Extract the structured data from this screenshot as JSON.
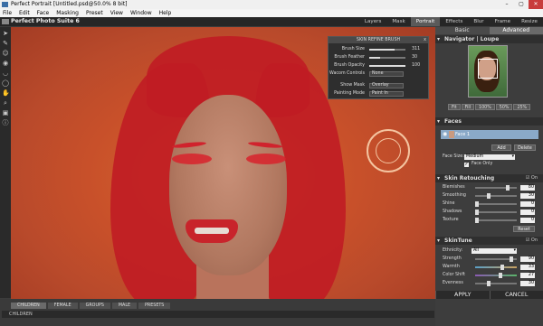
{
  "window": {
    "title": "Perfect Portrait [Untitled.psd@50.0% 8 bit]",
    "min": "–",
    "max": "▢",
    "close": "✕"
  },
  "menu": [
    "File",
    "Edit",
    "Face",
    "Masking",
    "Preset",
    "View",
    "Window",
    "Help"
  ],
  "app": {
    "name": "Perfect Photo Suite 6",
    "modules": [
      "Layers",
      "Mask",
      "Portrait",
      "Effects",
      "Blur",
      "Frame",
      "Resize"
    ],
    "active_module": "Portrait"
  },
  "brush_panel": {
    "title": "SKIN REFINE BRUSH",
    "close": "x",
    "size_label": "Brush Size",
    "size_value": "311",
    "size_level": 0.7,
    "feather_label": "Brush Feather",
    "feather_value": "30",
    "feather_level": 0.3,
    "opacity_label": "Brush Opacity",
    "opacity_value": "100",
    "opacity_level": 1.0,
    "wacom_label": "Wacom Controls",
    "wacom_value": "None",
    "showmask_label": "Show Mask",
    "showmask_value": "Overlay",
    "paintmode_label": "Painting Mode",
    "paintmode_value": "Paint In"
  },
  "bottom": {
    "tabs": [
      "CHILDREN",
      "FEMALE",
      "GROUPS",
      "MALE",
      "PRESETS"
    ],
    "active_tab": "CHILDREN",
    "breadcrumb": "CHILDREN"
  },
  "right_panel": {
    "tabs": [
      "Basic",
      "Advanced"
    ],
    "active_tab": "Advanced",
    "navigator_title": "Navigator | Loupe",
    "zoom_buttons": [
      "Fit",
      "Fill",
      "100%",
      "50%",
      "25%"
    ],
    "faces_title": "Faces",
    "face_item": "Face 1",
    "add_label": "Add",
    "delete_label": "Delete",
    "face_size_label": "Face Size:",
    "face_size_value": "Medium",
    "face_only_label": "Face Only",
    "skin_retouching_title": "Skin Retouching",
    "skin_retouching_on": "On",
    "retouch": [
      {
        "label": "Blemishes",
        "value": "80",
        "level": 0.8
      },
      {
        "label": "Smoothing",
        "value": "30",
        "level": 0.3
      },
      {
        "label": "Shine",
        "value": "0",
        "level": 0.0
      },
      {
        "label": "Shadows",
        "value": "0",
        "level": 0.0
      },
      {
        "label": "Texture",
        "value": "0",
        "level": 0.0
      }
    ],
    "reset_label": "Reset",
    "skintune_title": "SkinTune",
    "skintune_on": "On",
    "ethnicity_label": "Ethnicity:",
    "ethnicity_value": "All",
    "tune": [
      {
        "label": "Strength",
        "value": "90",
        "level": 0.9
      },
      {
        "label": "Warmth",
        "value": "33",
        "level": 0.66
      },
      {
        "label": "Color Shift",
        "value": "27",
        "level": 0.63
      },
      {
        "label": "Evenness",
        "value": "30",
        "level": 0.3
      }
    ],
    "apply_label": "APPLY",
    "cancel_label": "CANCEL"
  }
}
